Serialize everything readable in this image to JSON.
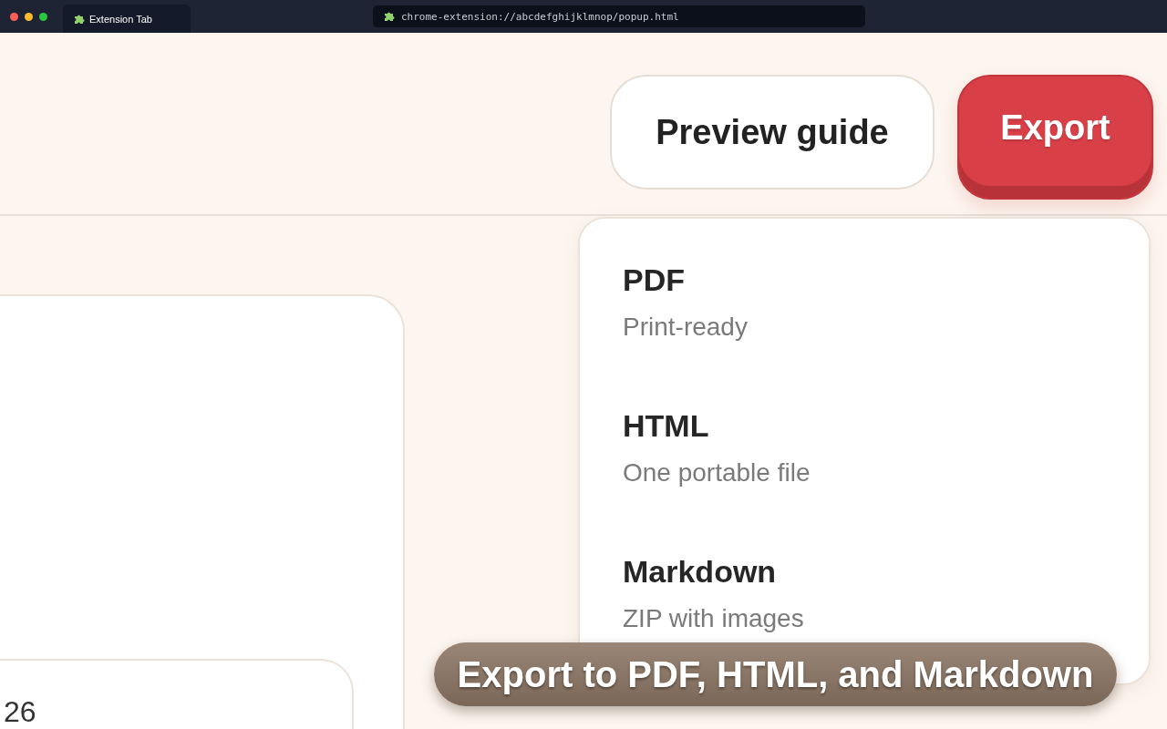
{
  "browser": {
    "tab_title": "Extension Tab",
    "url": "chrome-extension://abcdefghijklmnop/popup.html"
  },
  "header": {
    "buttons": [
      {
        "label": "Preview guide",
        "kind": "secondary"
      },
      {
        "label": "Export",
        "kind": "primary"
      }
    ]
  },
  "export_menu": {
    "items": [
      {
        "title": "PDF",
        "subtitle": "Print-ready"
      },
      {
        "title": "HTML",
        "subtitle": "One portable file"
      },
      {
        "title": "Markdown",
        "subtitle": "ZIP with images"
      }
    ]
  },
  "card": {
    "inner_value": "26"
  },
  "caption": "Export to PDF, HTML, and Markdown"
}
